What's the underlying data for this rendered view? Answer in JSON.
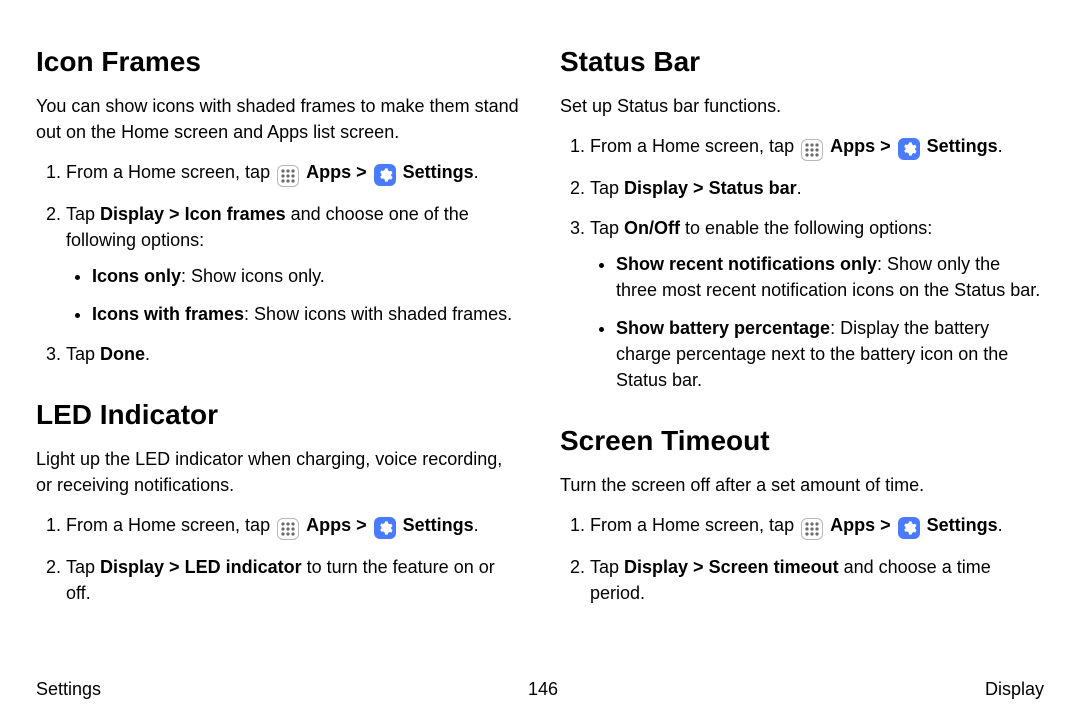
{
  "left": {
    "iconFrames": {
      "heading": "Icon Frames",
      "intro": "You can show icons with shaded frames to make them stand out on the Home screen and Apps list screen.",
      "step1_pre": "From a Home screen, tap ",
      "apps_label": "Apps",
      "gt": " > ",
      "settings_label": "Settings",
      "period": ".",
      "step2_pre": "Tap ",
      "step2_bold": "Display > Icon frames",
      "step2_post": " and choose one of the following options:",
      "opt1_bold": "Icons only",
      "opt1_rest": ": Show icons only.",
      "opt2_bold": "Icons with frames",
      "opt2_rest": ": Show icons with shaded frames.",
      "step3_pre": "Tap ",
      "step3_bold": "Done",
      "step3_post": "."
    },
    "ledIndicator": {
      "heading": "LED Indicator",
      "intro": "Light up the LED indicator when charging, voice recording, or receiving notifications.",
      "step1_pre": "From a Home screen, tap ",
      "apps_label": "Apps",
      "gt": " > ",
      "settings_label": "Settings",
      "period": ".",
      "step2_pre": "Tap ",
      "step2_bold": "Display > LED indicator",
      "step2_post": " to turn the feature on or off."
    }
  },
  "right": {
    "statusBar": {
      "heading": "Status Bar",
      "intro": "Set up Status bar functions.",
      "step1_pre": "From a Home screen, tap ",
      "apps_label": "Apps",
      "gt": " > ",
      "settings_label": "Settings",
      "period": ".",
      "step2_pre": "Tap ",
      "step2_bold": "Display > Status bar",
      "step2_post": ".",
      "step3_pre": "Tap ",
      "step3_bold": "On/Off",
      "step3_post": " to enable the following options:",
      "opt1_bold": "Show recent notifications only",
      "opt1_rest": ": Show only the three most recent notification icons on the Status bar.",
      "opt2_bold": "Show battery percentage",
      "opt2_rest": ": Display the battery charge percentage next to the battery icon on the Status bar."
    },
    "screenTimeout": {
      "heading": "Screen Timeout",
      "intro": "Turn the screen off after a set amount of time.",
      "step1_pre": "From a Home screen, tap ",
      "apps_label": "Apps",
      "gt": " > ",
      "settings_label": "Settings",
      "period": ".",
      "step2_pre": "Tap ",
      "step2_bold": "Display > Screen timeout",
      "step2_post": " and choose a time period."
    }
  },
  "footer": {
    "left": "Settings",
    "center": "146",
    "right": "Display"
  },
  "icons": {
    "apps": "apps-icon",
    "settings": "settings-icon"
  }
}
